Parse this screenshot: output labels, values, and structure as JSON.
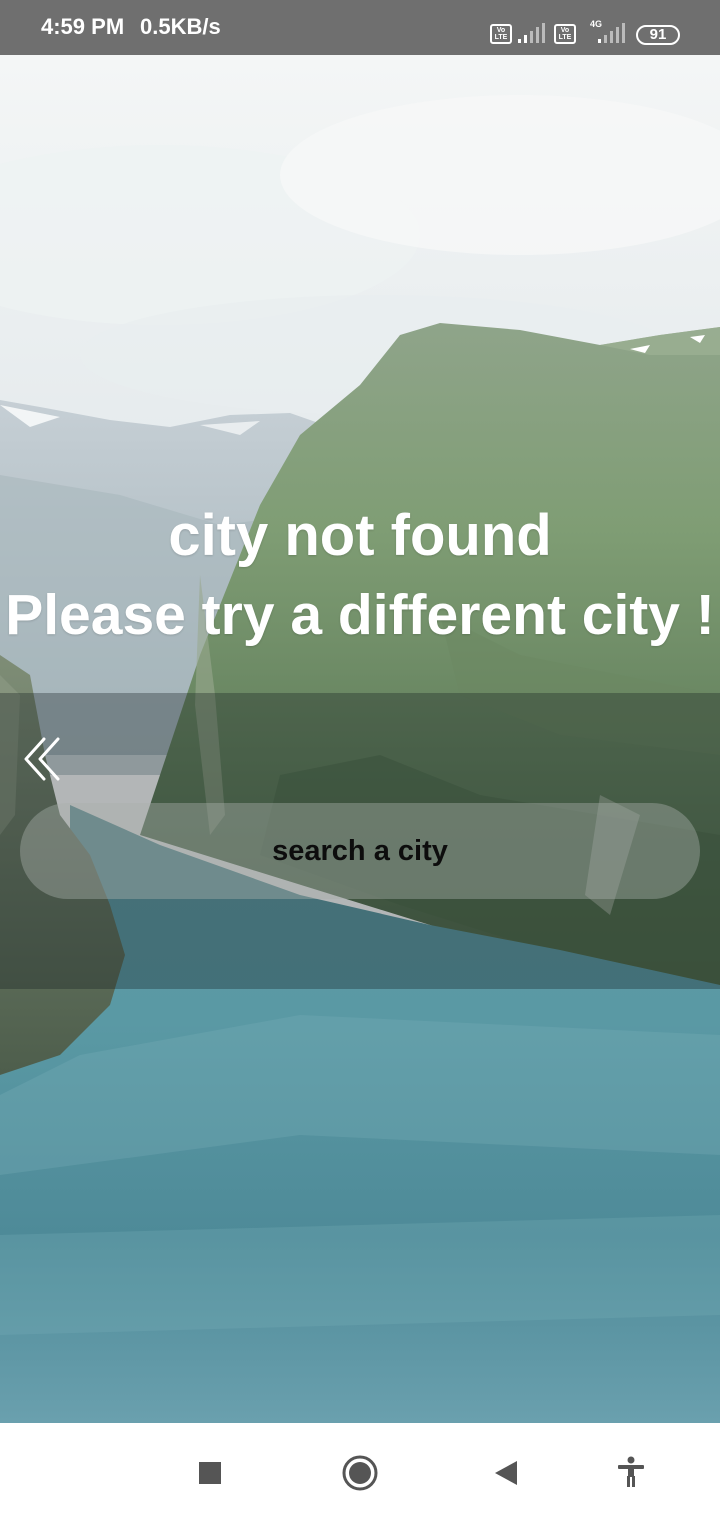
{
  "status_bar": {
    "time": "4:59 PM",
    "speed": "0.5KB/s",
    "sim1_badge": "Vo LTE",
    "sim2_badge": "Vo LTE",
    "network": "4G",
    "battery": "91"
  },
  "message": {
    "line1": "city not found",
    "line2": "Please try a different city !"
  },
  "search": {
    "placeholder": "search a city",
    "value": ""
  },
  "icons": {
    "back": "double-chevron-left-icon",
    "nav_recents": "square-icon",
    "nav_home": "circle-icon",
    "nav_back": "triangle-left-icon",
    "nav_accessibility": "accessibility-icon"
  },
  "colors": {
    "status_bar": "#6f6f6f",
    "message_text": "#ffffff",
    "nav_icons": "#555555"
  }
}
